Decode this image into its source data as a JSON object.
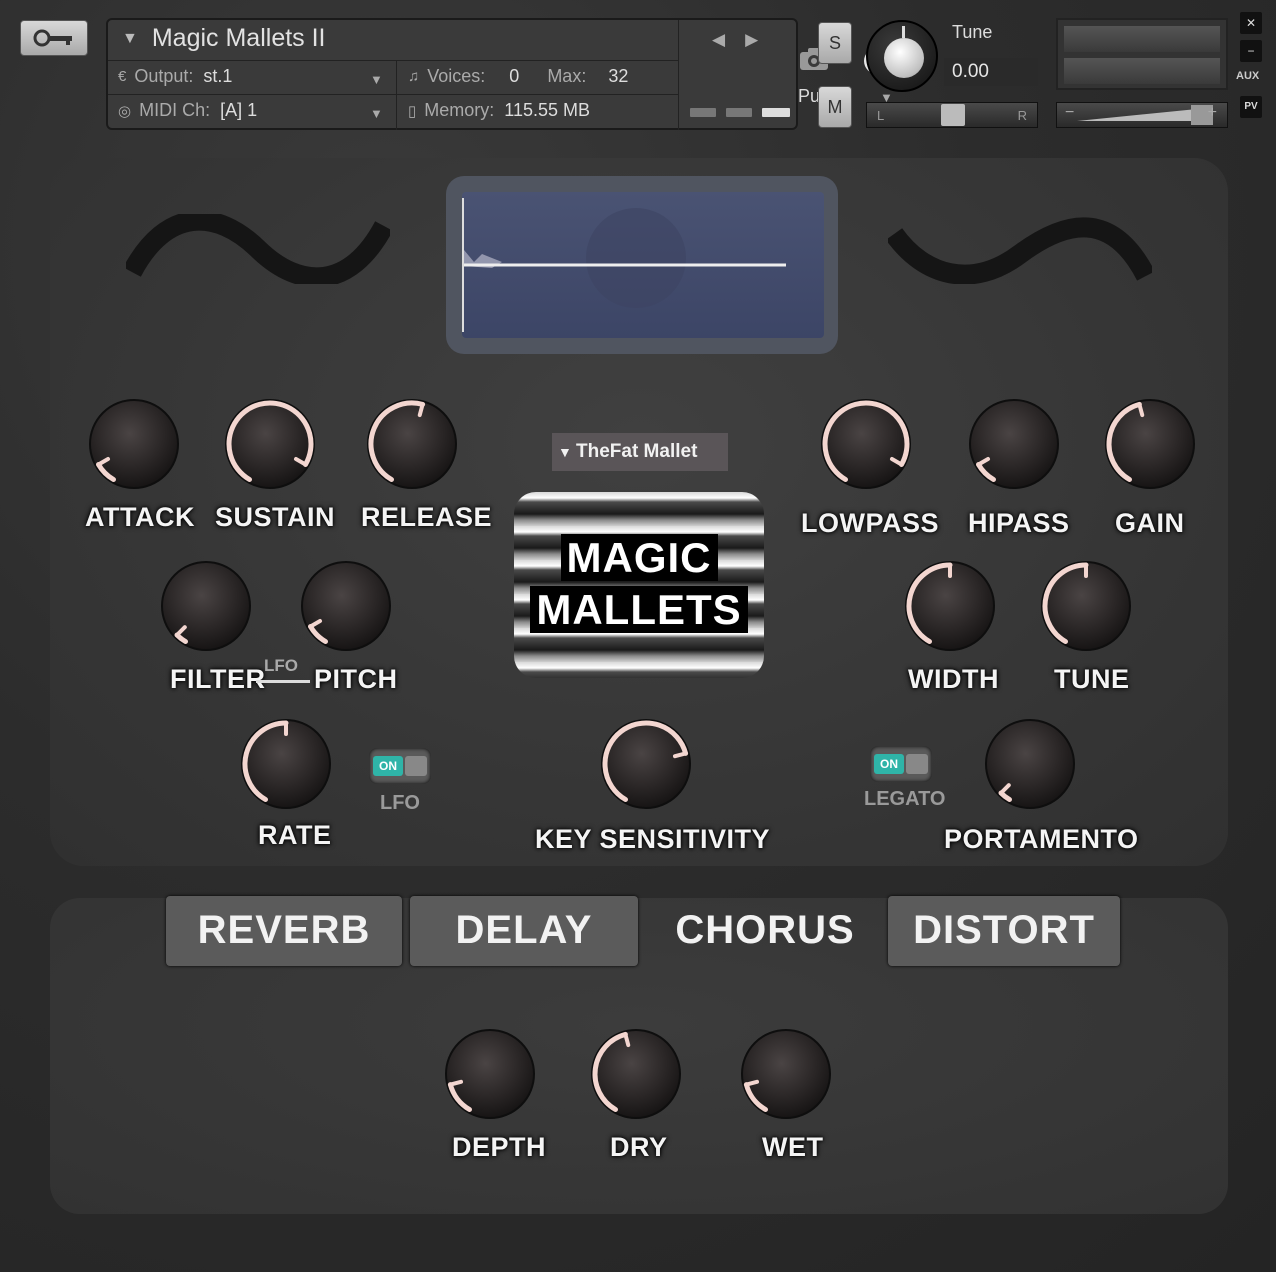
{
  "header": {
    "instrument_name": "Magic Mallets II",
    "output_label": "Output:",
    "output_value": "st.1",
    "voices_label": "Voices:",
    "voices_value": "0",
    "max_label": "Max:",
    "max_value": "32",
    "midi_label": "MIDI Ch:",
    "midi_value": "[A]  1",
    "memory_label": "Memory:",
    "memory_value": "115.55 MB",
    "purge_label": "Purge",
    "solo_label": "S",
    "mute_label": "M",
    "tune_label": "Tune",
    "tune_value": "0.00",
    "pan_left": "L",
    "pan_right": "R",
    "vol_minus": "−",
    "vol_plus": "+",
    "aux_label": "AUX",
    "pv_label": "PV",
    "close_label": "✕",
    "minimize_label": "−"
  },
  "preset": {
    "selected": "TheFat Mallet"
  },
  "logo": {
    "line1": "MAGIC",
    "line2": "MALLETS"
  },
  "knobs": {
    "attack": {
      "label": "ATTACK",
      "value": 0.1
    },
    "sustain": {
      "label": "SUSTAIN",
      "value": 0.9
    },
    "release": {
      "label": "RELEASE",
      "value": 0.55
    },
    "filter": {
      "label": "FILTER",
      "value": 0.05
    },
    "pitch": {
      "label": "PITCH",
      "value": 0.1
    },
    "rate": {
      "label": "RATE",
      "value": 0.5
    },
    "key_sensitivity": {
      "label": "KEY SENSITIVITY",
      "value": 0.75
    },
    "lowpass": {
      "label": "LOWPASS",
      "value": 0.9
    },
    "hipass": {
      "label": "HIPASS",
      "value": 0.1
    },
    "gain": {
      "label": "GAIN",
      "value": 0.45
    },
    "width": {
      "label": "WIDTH",
      "value": 0.5
    },
    "tune": {
      "label": "TUNE",
      "value": 0.5
    },
    "portamento": {
      "label": "PORTAMENTO",
      "value": 0.05
    },
    "depth": {
      "label": "DEPTH",
      "value": 0.15
    },
    "dry": {
      "label": "DRY",
      "value": 0.45
    },
    "wet": {
      "label": "WET",
      "value": 0.15
    }
  },
  "lfo": {
    "link_label": "LFO",
    "toggle_label": "LFO",
    "toggle_state": "ON"
  },
  "legato": {
    "toggle_label": "LEGATO",
    "toggle_state": "ON"
  },
  "fx_tabs": [
    {
      "label": "REVERB",
      "active": false
    },
    {
      "label": "DELAY",
      "active": false
    },
    {
      "label": "CHORUS",
      "active": true
    },
    {
      "label": "DISTORT",
      "active": false
    }
  ],
  "colors": {
    "knob_arc": "#f3d6d0",
    "toggle_on": "#2fb4a8",
    "screen_bg": "#434c6c"
  }
}
